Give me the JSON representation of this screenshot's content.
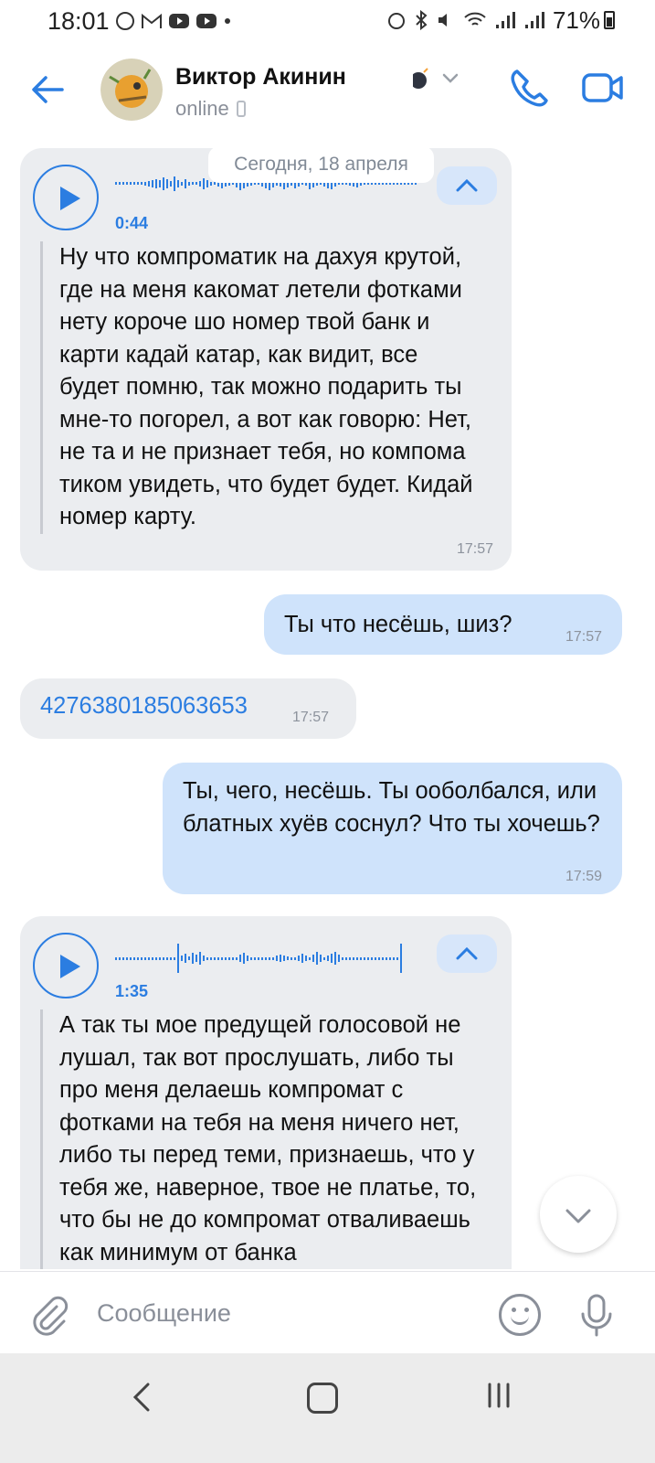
{
  "status_bar": {
    "time": "18:01",
    "battery": "71%"
  },
  "header": {
    "name": "Виктор Акинин",
    "status": "online"
  },
  "chat": {
    "date_chip": "Сегодня, 18 апреля",
    "messages": [
      {
        "duration": "0:44",
        "text": "Ну что компроматик на дахуя крутой, где на меня какомат летели фотками нету короче шо номер твой банк и карти кадай катар, как видит, все будет помню, так можно подарить ты мне-то погорел, а вот как говорю: Нет, не та и не признает тебя, но компома тиком увидеть, что будет будет. Кидай номер карту.",
        "time": "17:57"
      },
      {
        "text": "Ты что несёшь, шиз?",
        "time": "17:57"
      },
      {
        "text": "4276380185063653",
        "time": "17:57"
      },
      {
        "text": "Ты, чего, несёшь. Ты ооболбался, или блатных хуёв соснул? Что ты хочешь?",
        "time": "17:59"
      },
      {
        "duration": "1:35",
        "text": "А так ты мое предущей голосовой не лушал, так вот прослушать, либо ты про меня делаешь компромат с фотками на тебя на меня ничего нет, либо ты перед теми, признаешь, что у тебя же, наверное, твое не платье, то, что бы не до компромат отваливаешь как минимум от банка"
      }
    ]
  },
  "composer": {
    "placeholder": "Сообщение"
  },
  "colors": {
    "accent": "#2b7de1",
    "incoming_bubble": "#ebedf0",
    "outgoing_bubble": "#cfe3fb"
  }
}
